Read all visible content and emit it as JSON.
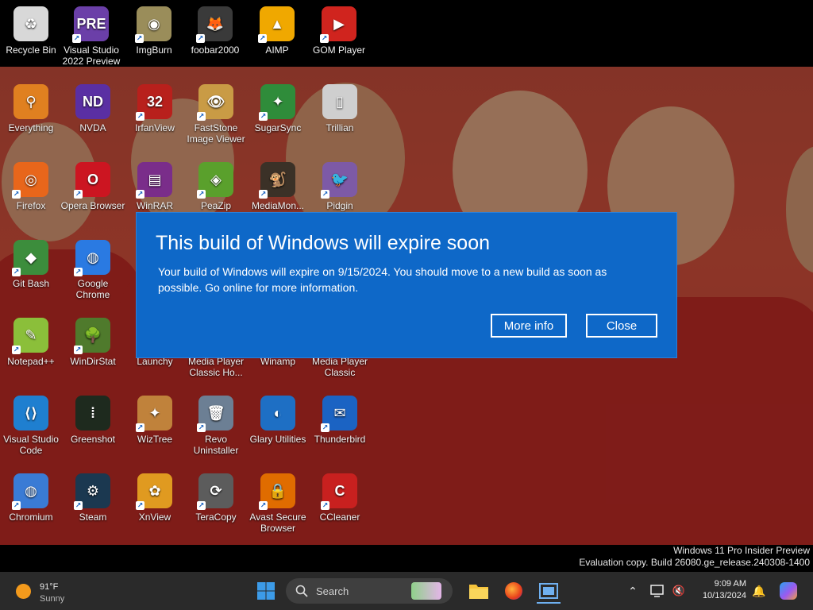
{
  "top_icons": [
    {
      "label": "Recycle Bin",
      "icon": "recycle-bin-icon",
      "color": "#d8d8d8",
      "glyph": "♻",
      "shortcut": false
    },
    {
      "label": "Visual Studio 2022 Preview",
      "icon": "visual-studio-preview-icon",
      "color": "#6b3fa8",
      "glyph": "PRE",
      "shortcut": true
    },
    {
      "label": "ImgBurn",
      "icon": "imgburn-icon",
      "color": "#9a8d5a",
      "glyph": "◉",
      "shortcut": true
    },
    {
      "label": "foobar2000",
      "icon": "foobar2000-icon",
      "color": "#3a3a3a",
      "glyph": "🦊",
      "shortcut": true
    },
    {
      "label": "AIMP",
      "icon": "aimp-icon",
      "color": "#f0a800",
      "glyph": "▲",
      "shortcut": true
    },
    {
      "label": "GOM Player",
      "icon": "gom-player-icon",
      "color": "#d0241e",
      "glyph": "▶",
      "shortcut": true
    }
  ],
  "grid_icons": [
    {
      "label": "Everything",
      "icon": "everything-search-icon",
      "color": "#e08020",
      "glyph": "⚲",
      "col": 0,
      "row": 0,
      "shortcut": false
    },
    {
      "label": "NVDA",
      "icon": "nvda-icon",
      "color": "#5a2fa3",
      "glyph": "ND",
      "col": 1,
      "row": 0,
      "shortcut": false
    },
    {
      "label": "IrfanView",
      "icon": "irfanview-icon",
      "color": "#b8201c",
      "glyph": "32",
      "col": 2,
      "row": 0,
      "shortcut": true
    },
    {
      "label": "FastStone Image Viewer",
      "icon": "faststone-icon",
      "color": "#c99b45",
      "glyph": "👁",
      "col": 3,
      "row": 0,
      "shortcut": true
    },
    {
      "label": "SugarSync",
      "icon": "sugarsync-icon",
      "color": "#2f8c3a",
      "glyph": "✦",
      "col": 4,
      "row": 0,
      "shortcut": true
    },
    {
      "label": "Trillian",
      "icon": "trillian-icon",
      "color": "#cfcfcf",
      "glyph": "▯",
      "col": 5,
      "row": 0,
      "shortcut": false
    },
    {
      "label": "Firefox",
      "icon": "firefox-icon",
      "color": "#e8661b",
      "glyph": "◎",
      "col": 0,
      "row": 1,
      "shortcut": true
    },
    {
      "label": "Opera Browser",
      "icon": "opera-icon",
      "color": "#cc1521",
      "glyph": "O",
      "col": 1,
      "row": 1,
      "shortcut": true
    },
    {
      "label": "WinRAR",
      "icon": "winrar-icon",
      "color": "#7a2d8a",
      "glyph": "▤",
      "col": 2,
      "row": 1,
      "shortcut": true
    },
    {
      "label": "PeaZip",
      "icon": "peazip-icon",
      "color": "#5aa02c",
      "glyph": "◈",
      "col": 3,
      "row": 1,
      "shortcut": true
    },
    {
      "label": "MediaMon...",
      "icon": "mediamonkey-icon",
      "color": "#3b3127",
      "glyph": "🐒",
      "col": 4,
      "row": 1,
      "shortcut": true
    },
    {
      "label": "Pidgin",
      "icon": "pidgin-icon",
      "color": "#7d5aa6",
      "glyph": "🐦",
      "col": 5,
      "row": 1,
      "shortcut": true
    },
    {
      "label": "Git Bash",
      "icon": "git-bash-icon",
      "color": "#3c8d3c",
      "glyph": "◆",
      "col": 0,
      "row": 2,
      "shortcut": true
    },
    {
      "label": "Google Chrome",
      "icon": "chrome-icon",
      "color": "#2a7ae2",
      "glyph": "◍",
      "col": 1,
      "row": 2,
      "shortcut": true
    },
    {
      "label": "Notepad++",
      "icon": "notepad-plus-plus-icon",
      "color": "#8bbf3a",
      "glyph": "✎",
      "col": 0,
      "row": 3,
      "shortcut": true
    },
    {
      "label": "WinDirStat",
      "icon": "windirstat-icon",
      "color": "#4f7a2c",
      "glyph": "🌳",
      "col": 1,
      "row": 3,
      "shortcut": true
    },
    {
      "label": "Launchy",
      "icon": "launchy-icon",
      "color": "#9f2a2a",
      "glyph": "➶",
      "col": 2,
      "row": 3,
      "shortcut": false
    },
    {
      "label": "Media Player Classic Ho...",
      "icon": "mpc-hc-icon",
      "color": "#3f3f3f",
      "glyph": "▶",
      "col": 3,
      "row": 3,
      "shortcut": false
    },
    {
      "label": "Winamp",
      "icon": "winamp-icon",
      "color": "#b58a30",
      "glyph": "⚡",
      "col": 4,
      "row": 3,
      "shortcut": false
    },
    {
      "label": "Media Player Classic",
      "icon": "mpc-icon",
      "color": "#3f3f3f",
      "glyph": "▶",
      "col": 5,
      "row": 3,
      "shortcut": false
    },
    {
      "label": "Visual Studio Code",
      "icon": "vscode-icon",
      "color": "#1f7fd0",
      "glyph": "⟨⟩",
      "col": 0,
      "row": 4,
      "shortcut": false
    },
    {
      "label": "Greenshot",
      "icon": "greenshot-icon",
      "color": "#1e2a1e",
      "glyph": "⁞",
      "col": 1,
      "row": 4,
      "shortcut": false
    },
    {
      "label": "WizTree",
      "icon": "wiztree-icon",
      "color": "#c0823b",
      "glyph": "✦",
      "col": 2,
      "row": 4,
      "shortcut": true
    },
    {
      "label": "Revo Uninstaller",
      "icon": "revo-uninstaller-icon",
      "color": "#6c7f94",
      "glyph": "🗑",
      "col": 3,
      "row": 4,
      "shortcut": true
    },
    {
      "label": "Glary Utilities",
      "icon": "glary-utilities-icon",
      "color": "#1e6fc4",
      "glyph": "◐",
      "col": 4,
      "row": 4,
      "shortcut": false
    },
    {
      "label": "Thunderbird",
      "icon": "thunderbird-icon",
      "color": "#1b63c3",
      "glyph": "✉",
      "col": 5,
      "row": 4,
      "shortcut": true
    },
    {
      "label": "Chromium",
      "icon": "chromium-icon",
      "color": "#3a7bd5",
      "glyph": "◍",
      "col": 0,
      "row": 5,
      "shortcut": true
    },
    {
      "label": "Steam",
      "icon": "steam-icon",
      "color": "#1b3850",
      "glyph": "⚙",
      "col": 1,
      "row": 5,
      "shortcut": true
    },
    {
      "label": "XnView",
      "icon": "xnview-icon",
      "color": "#e09a20",
      "glyph": "✿",
      "col": 2,
      "row": 5,
      "shortcut": true
    },
    {
      "label": "TeraCopy",
      "icon": "teracopy-icon",
      "color": "#5c5c5c",
      "glyph": "⟳",
      "col": 3,
      "row": 5,
      "shortcut": true
    },
    {
      "label": "Avast Secure Browser",
      "icon": "avast-secure-browser-icon",
      "color": "#e06c00",
      "glyph": "🔒",
      "col": 4,
      "row": 5,
      "shortcut": true
    },
    {
      "label": "CCleaner",
      "icon": "ccleaner-icon",
      "color": "#c8201f",
      "glyph": "C",
      "col": 5,
      "row": 5,
      "shortcut": true
    }
  ],
  "dialog": {
    "title": "This build of Windows will expire soon",
    "message": "Your build of Windows will expire on 9/15/2024. You should move to a new build as soon as possible. Go online for more information.",
    "more_info_label": "More info",
    "close_label": "Close"
  },
  "watermark": {
    "line1": "Windows 11 Pro Insider Preview",
    "line2": "Evaluation copy. Build 26080.ge_release.240308-1400"
  },
  "taskbar": {
    "weather_temp": "91°F",
    "weather_desc": "Sunny",
    "search_placeholder": "Search",
    "time": "9:09 AM",
    "date": "10/13/2024"
  }
}
